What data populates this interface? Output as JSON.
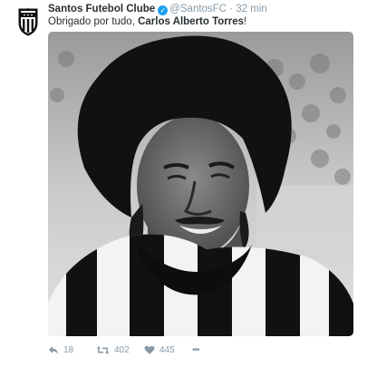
{
  "tweet": {
    "author_name": "Santos Futebol Clube",
    "author_handle": "@SantosFC",
    "separator": "·",
    "time": "32 min",
    "text_prefix": "Obrigado por tudo, ",
    "text_bold": "Carlos Alberto Torres",
    "text_suffix": "!",
    "avatar_icon": "santos-crest-icon",
    "verified_icon": "verified-badge-icon",
    "verified_glyph": "✓",
    "photo_subject": "Carlos Alberto Torres"
  },
  "actions": {
    "reply_count": "18",
    "retweet_count": "402",
    "like_count": "445",
    "more_glyph": "•••",
    "reply_icon": "reply-icon",
    "retweet_icon": "retweet-icon",
    "like_icon": "heart-icon",
    "more_icon": "more-icon"
  },
  "colors": {
    "accent": "#1da1f2",
    "muted": "#8899a6",
    "text": "#292f33"
  }
}
